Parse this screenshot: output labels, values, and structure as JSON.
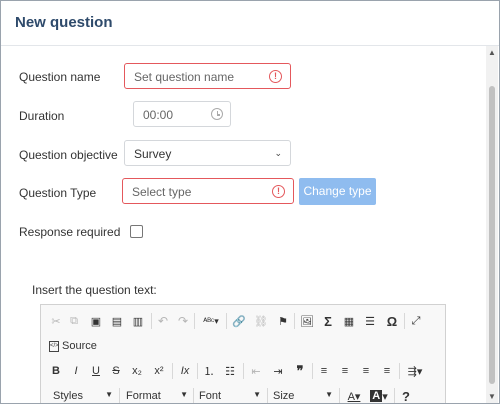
{
  "dialog": {
    "title": "New question"
  },
  "form": {
    "question_name": {
      "label": "Question name",
      "placeholder": "Set question name"
    },
    "duration": {
      "label": "Duration",
      "value": "00:00"
    },
    "objective": {
      "label": "Question objective",
      "value": "Survey"
    },
    "type": {
      "label": "Question Type",
      "placeholder": "Select type",
      "button": "Change type"
    },
    "response_required": {
      "label": "Response required",
      "checked": false
    }
  },
  "editor": {
    "label": "Insert the question text:",
    "source_label": "Source",
    "combos": {
      "styles": "Styles",
      "format": "Format",
      "font": "Font",
      "size": "Size"
    },
    "icons": {
      "bold": "B",
      "italic": "I",
      "underline": "U",
      "strike": "S",
      "subscript": "x₂",
      "superscript": "x²",
      "clear_format": "Ix",
      "quote": "❞",
      "omega": "Ω",
      "sigma": "Σ",
      "help": "?"
    }
  },
  "colors": {
    "title": "#2e4a6b",
    "error": "#e4585c",
    "button": "#8fbcef"
  }
}
